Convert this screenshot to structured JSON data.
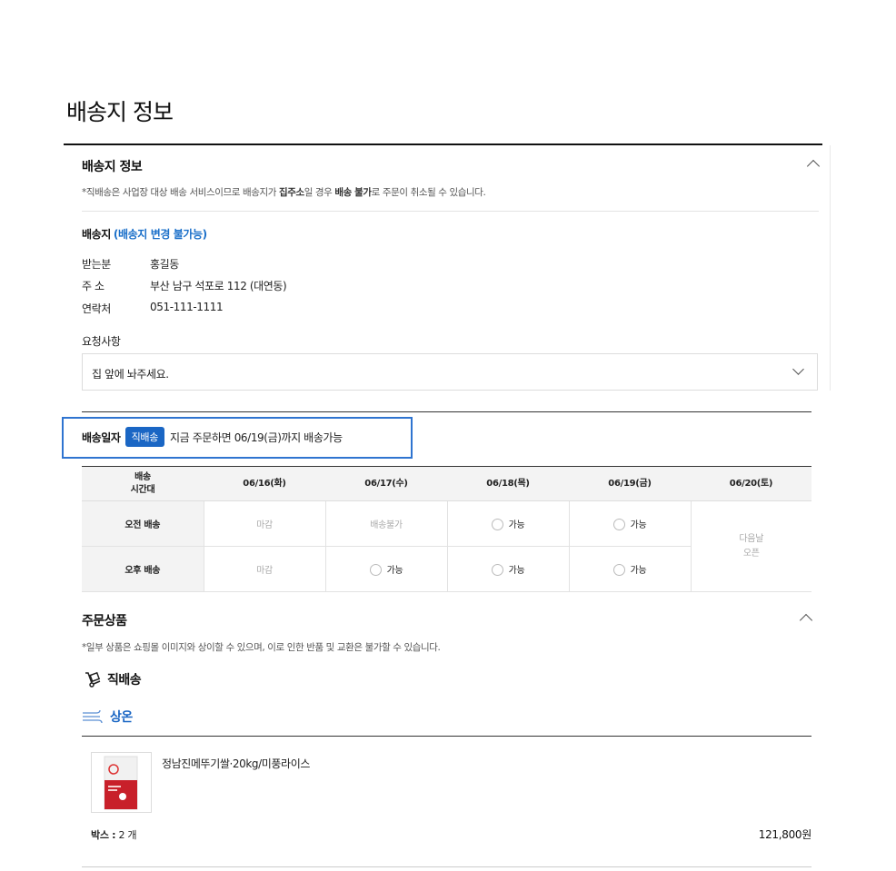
{
  "page_title": "배송지 정보",
  "shipping_section": {
    "title": "배송지 정보",
    "note_prefix": "*직배송은 사업장 대상 배송 서비스이므로 배송지가 ",
    "note_bold1": "집주소",
    "note_mid": "일 경우 ",
    "note_bold2": "배송 불가",
    "note_suffix": "로 주문이 취소될 수 있습니다."
  },
  "address": {
    "heading": "배송지",
    "heading_note": "(배송지 변경 불가능)",
    "rows": [
      {
        "label": "받는분",
        "value": "홍길동"
      },
      {
        "label": "주 소",
        "value": "부산 남구 석포로 112 (대연동)"
      },
      {
        "label": "연락처",
        "value": "051-111-1111"
      }
    ]
  },
  "request": {
    "label": "요청사항",
    "selected": "집 앞에 놔주세요."
  },
  "delivery_date": {
    "label": "배송일자",
    "badge": "직배송",
    "text": "지금 주문하면 06/19(금)까지 배송가능"
  },
  "schedule": {
    "header_line1": "배송",
    "header_line2": "시간대",
    "dates": [
      "06/16(화)",
      "06/17(수)",
      "06/18(목)",
      "06/19(금)",
      "06/20(토)"
    ],
    "morning_label": "오전 배송",
    "afternoon_label": "오후 배송",
    "morning": [
      "마감",
      "배송불가",
      "가능",
      "가능"
    ],
    "afternoon": [
      "마감",
      "가능",
      "가능",
      "가능"
    ],
    "next_day_line1": "다음날",
    "next_day_line2": "오픈"
  },
  "order_section": {
    "title": "주문상품",
    "note": "*일부 상품은 쇼핑몰 이미지와 상이할 수 있으며, 이로 인한 반품 및 교환은 불가할 수 있습니다.",
    "delivery_type": "직배송",
    "temperature": "상온"
  },
  "product": {
    "name": "정남진메뚜기쌀·20kg/미풍라이스",
    "qty_label": "박스 :",
    "qty_value": "2 개",
    "price": "121,800원"
  },
  "colors": {
    "accent": "#1a66c4",
    "highlight_border": "#2f74d0"
  },
  "icons": [
    "chevron-up-icon",
    "chevron-down-icon",
    "hand-truck-icon",
    "wind-icon",
    "radio-icon"
  ]
}
